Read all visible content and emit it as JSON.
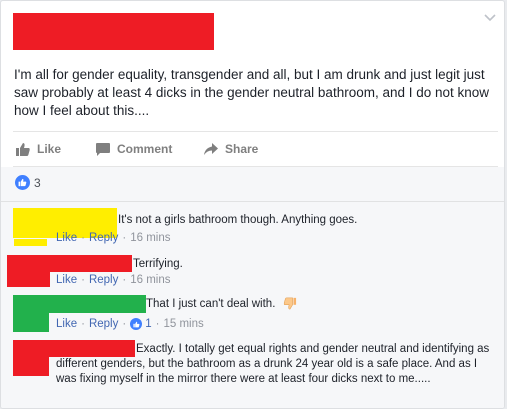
{
  "post": {
    "text": "I'm all for gender equality, transgender and all, but I am drunk and just legit just saw probably at least 4 dicks in the gender neutral bathroom, and I do not know how I feel about this...."
  },
  "actions": {
    "like_label": "Like",
    "comment_label": "Comment",
    "share_label": "Share"
  },
  "reactions": {
    "count": "3"
  },
  "comments": [
    {
      "text": "It's not a girls bathroom though. Anything goes.",
      "like_label": "Like",
      "reply_label": "Reply",
      "time": "16 mins"
    },
    {
      "text": "Terrifying.",
      "like_label": "Like",
      "reply_label": "Reply",
      "time": "16 mins"
    },
    {
      "text": "That I just can't deal with.",
      "like_label": "Like",
      "reply_label": "Reply",
      "likes": "1",
      "time": "15 mins"
    },
    {
      "text": "Exactly. I totally get equal rights and gender neutral and identifying as different genders, but the bathroom as a drunk 24 year old is a safe place. And as I was fixing myself in the mirror there were at least four dicks next to me....."
    }
  ],
  "colors": {
    "redact_red": "#ee1c25",
    "redact_yellow": "#ffee00",
    "redact_green": "#22b14c",
    "link_blue": "#4267b2",
    "like_blue": "#4080ff"
  },
  "icons": [
    "chevron-down-icon",
    "thumbs-up-icon",
    "comment-icon",
    "share-icon",
    "like-reaction-icon",
    "thumbs-down-emoji-icon"
  ]
}
